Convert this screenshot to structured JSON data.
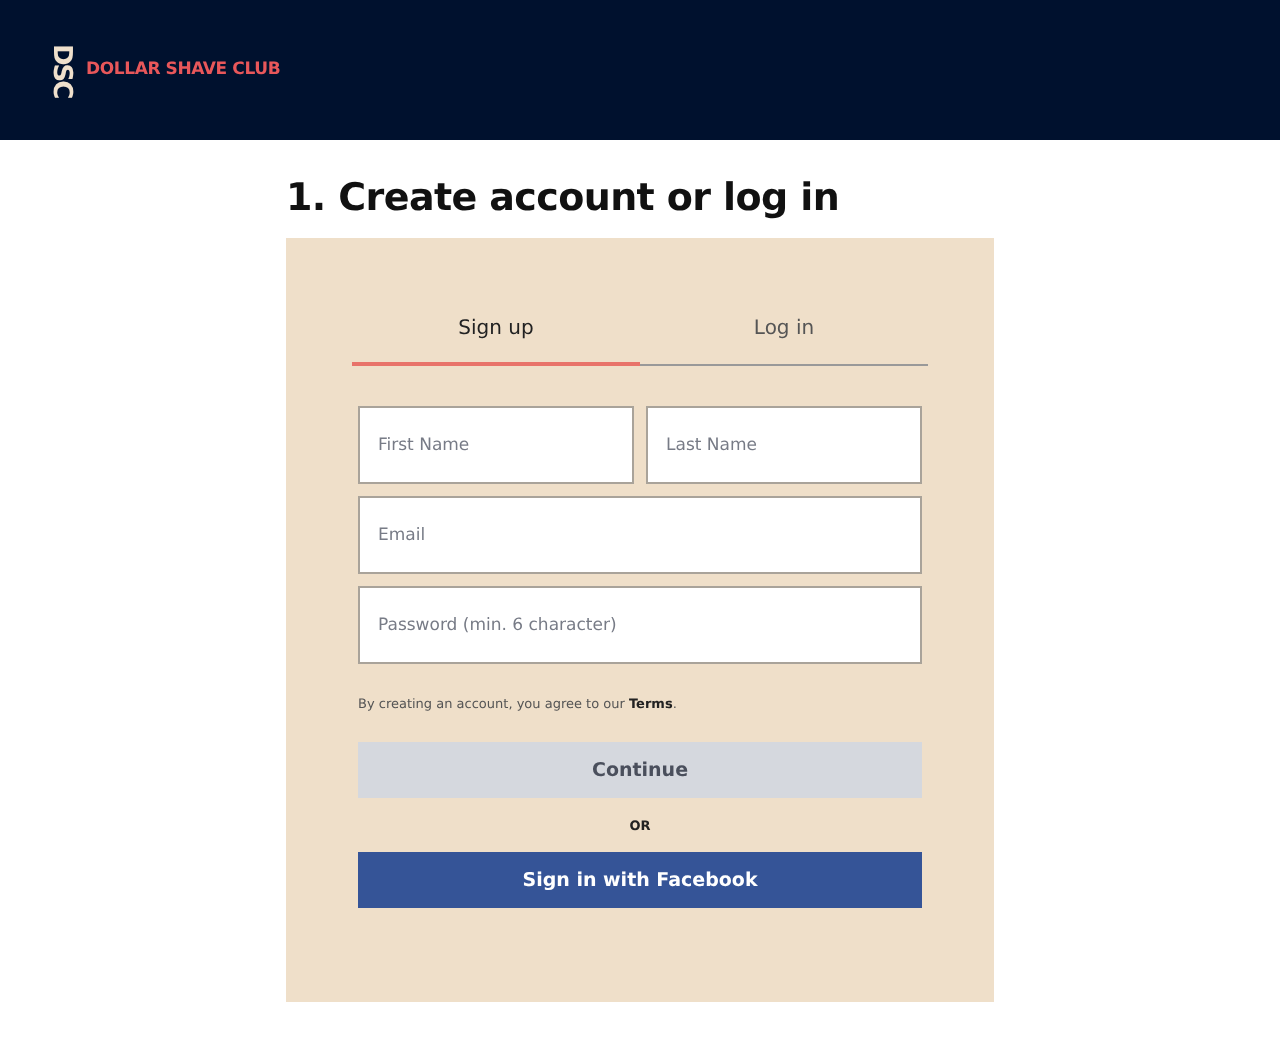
{
  "header": {
    "logo_mark": "DSC",
    "brand": "DOLLAR SHAVE CLUB"
  },
  "heading": "1. Create account or log in",
  "tabs": [
    {
      "label": "Sign up",
      "selected": true
    },
    {
      "label": "Log in",
      "selected": false
    }
  ],
  "fields": [
    {
      "placeholder": "First Name",
      "kind": "half"
    },
    {
      "placeholder": "Last Name",
      "kind": "half"
    },
    {
      "placeholder": "Email",
      "kind": "full"
    },
    {
      "placeholder": "Password (min. 6 character)",
      "kind": "full"
    }
  ],
  "terms": {
    "text": "By creating an account, you agree to our",
    "link": "Terms",
    "after": "."
  },
  "continue_button": {
    "label": "Continue",
    "disabled": true
  },
  "separator": "OR",
  "facebook_button": {
    "label": "Sign in with Facebook"
  }
}
